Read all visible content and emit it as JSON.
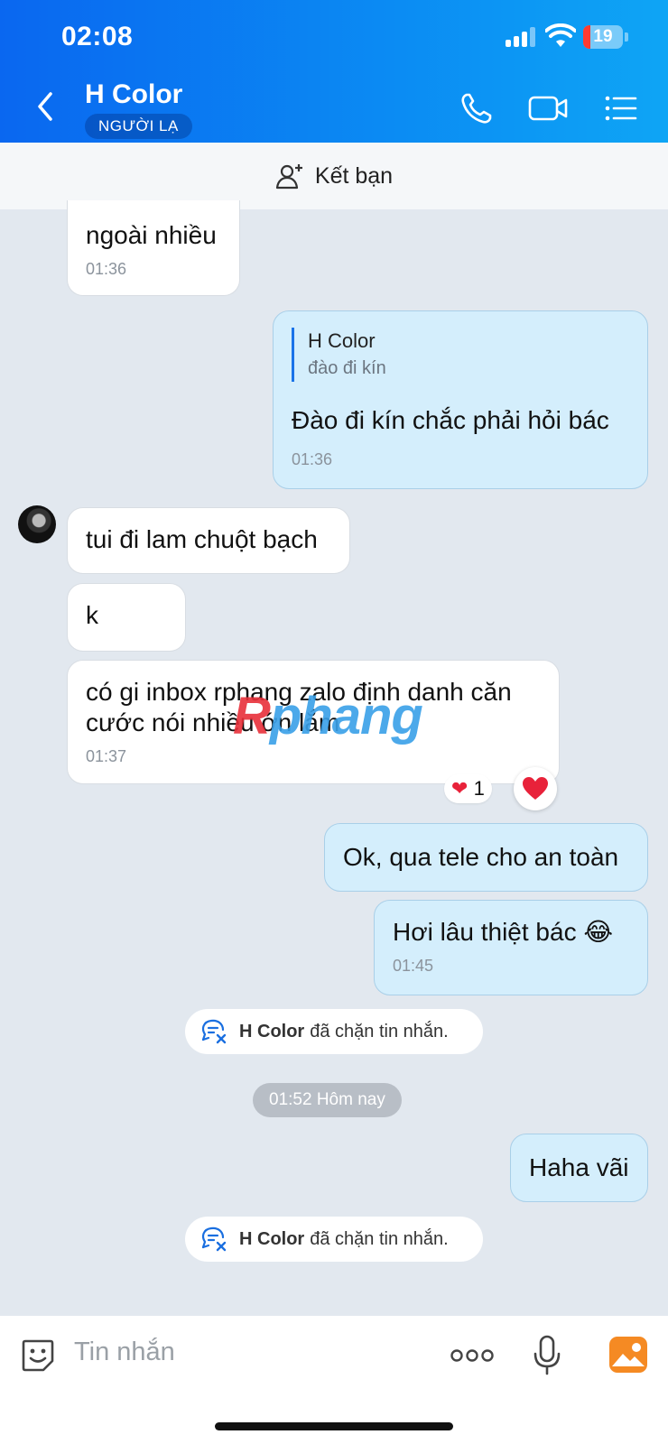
{
  "status_bar": {
    "time": "02:08",
    "battery": "19"
  },
  "header": {
    "title": "H Color",
    "badge": "NGƯỜI LẠ"
  },
  "friend_bar": {
    "label": "Kết bạn"
  },
  "messages": {
    "m1": {
      "text": "ngoài nhiều",
      "time": "01:36"
    },
    "m2": {
      "reply_name": "H Color",
      "reply_text": "đào đi kín",
      "text": "Đào đi kín chắc phải hỏi bác",
      "time": "01:36"
    },
    "m3": {
      "text": "tui đi lam chuột bạch"
    },
    "m4": {
      "text": "k"
    },
    "m5": {
      "text": "có gi inbox rphang zalo định danh căn cước nói nhiều ớn lắm",
      "time": "01:37",
      "reaction_count": "1"
    },
    "m6": {
      "text": "Ok, qua tele cho an toàn"
    },
    "m7": {
      "text": "Hơi lâu thiệt bác 😂",
      "time": "01:45"
    },
    "m8": {
      "text": "Haha vãi"
    }
  },
  "system": {
    "blocked_1": {
      "name": "H Color",
      "text": "đã chặn tin nhắn."
    },
    "blocked_2": {
      "name": "H Color",
      "text": "đã chặn tin nhắn."
    },
    "date_divider": "01:52 Hôm nay"
  },
  "watermark": {
    "first": "R",
    "rest": "phang"
  },
  "input": {
    "placeholder": "Tin nhắn"
  },
  "colors": {
    "header_start": "#0a67f0",
    "header_end": "#0ea5f5",
    "outgoing": "#d4eefc",
    "incoming": "#ffffff",
    "background": "#e2e8ef"
  },
  "icons": [
    "back-chevron-icon",
    "phone-icon",
    "video-icon",
    "menu-list-icon",
    "add-friend-icon",
    "blocked-message-icon",
    "heart-icon",
    "sticker-icon",
    "more-dots-icon",
    "microphone-icon",
    "image-icon"
  ]
}
